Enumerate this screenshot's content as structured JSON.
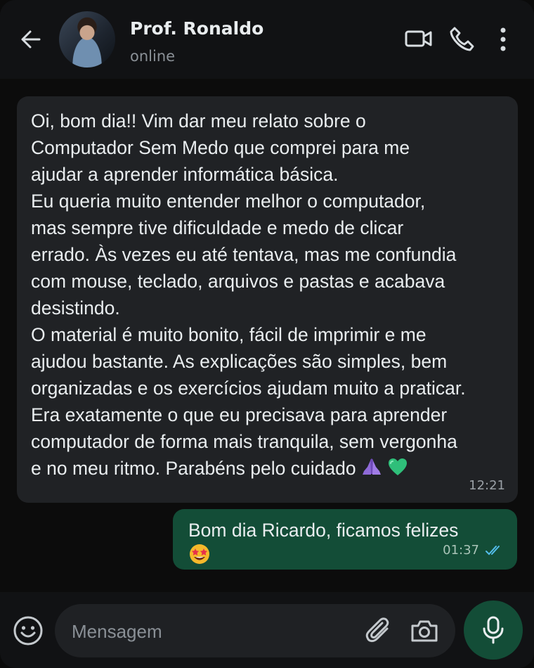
{
  "header": {
    "contact_name": "Prof. Ronaldo",
    "status": "online",
    "icons": [
      "back-arrow-icon",
      "avatar",
      "video-call-icon",
      "phone-icon",
      "more-options-icon"
    ]
  },
  "messages": [
    {
      "direction": "incoming",
      "text": "Oi, bom dia!! Vim dar meu relato sobre o\nComputador Sem Medo que comprei para me\najudar a aprender informática básica.\nEu queria muito entender melhor o computador,\nmas sempre tive dificuldade e medo de clicar\nerrado. Às vezes eu até tentava, mas me confundia\ncom mouse, teclado, arquivos e pastas e acabava\ndesistindo.\nO material é muito bonito, fácil de imprimir e me\najudou bastante. As explicações são simples, bem\norganizadas e os exercícios ajudam muito a praticar.\nEra exatamente o que eu precisava para aprender\ncomputador de forma mais tranquila, sem vergonha\ne no meu ritmo. Parabéns pelo cuidado ",
      "emojis": [
        "folded-hands-emoji",
        "green-heart-emoji"
      ],
      "time": "12:21"
    },
    {
      "direction": "outgoing",
      "text": "Bom dia Ricardo, ficamos felizes",
      "emojis": [
        "star-struck-emoji"
      ],
      "time": "01:37",
      "read_status": "double-check-read"
    }
  ],
  "composer": {
    "placeholder": "Mensagem",
    "value": ""
  },
  "colors": {
    "background": "#0c0c0c",
    "incoming_bubble": "#202225",
    "outgoing_bubble": "#134d37",
    "read_ticks": "#53bdeb",
    "icons": "#d8dde1"
  }
}
